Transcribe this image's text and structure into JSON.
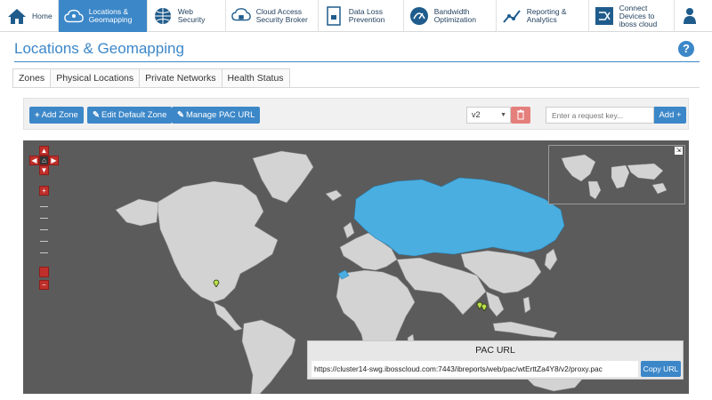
{
  "nav": {
    "items": [
      {
        "label": "Home",
        "icon": "home-icon",
        "active": false
      },
      {
        "label": "Locations &\nGeomapping",
        "icon": "cloud-pin-icon",
        "active": true
      },
      {
        "label": "Web Security",
        "icon": "globe-icon",
        "active": false
      },
      {
        "label": "Cloud Access\nSecurity Broker",
        "icon": "cloud-lock-icon",
        "active": false
      },
      {
        "label": "Data Loss\nPrevention",
        "icon": "document-lock-icon",
        "active": false
      },
      {
        "label": "Bandwidth\nOptimization",
        "icon": "speedometer-icon",
        "active": false
      },
      {
        "label": "Reporting &\nAnalytics",
        "icon": "chart-icon",
        "active": false
      },
      {
        "label": "Connect\nDevices to\niboss cloud",
        "icon": "connect-icon",
        "active": false
      },
      {
        "label": "",
        "icon": "user-icon",
        "active": false
      }
    ]
  },
  "page": {
    "title": "Locations & Geomapping",
    "help": "?"
  },
  "tabs": [
    {
      "label": "Zones",
      "active": true
    },
    {
      "label": "Physical Locations",
      "active": false
    },
    {
      "label": "Private Networks",
      "active": false
    },
    {
      "label": "Health Status",
      "active": false
    }
  ],
  "toolbar": {
    "add_zone": "Add Zone",
    "edit_default_zone": "Edit Default Zone",
    "manage_pac_url": "Manage PAC URL",
    "version_value": "v2",
    "request_key_placeholder": "Enter a request key...",
    "add_label": "Add"
  },
  "map": {
    "highlight_color": "#4aaee0",
    "land_color": "#d3d3d3",
    "water_color": "#5b5b5b"
  },
  "pac": {
    "title": "PAC URL",
    "url": "https://cluster14-swg.ibosscloud.com:7443/ibreports/web/pac/wtErttZa4Y8/v2/proxy.pac",
    "copy_label": "Copy URL"
  }
}
